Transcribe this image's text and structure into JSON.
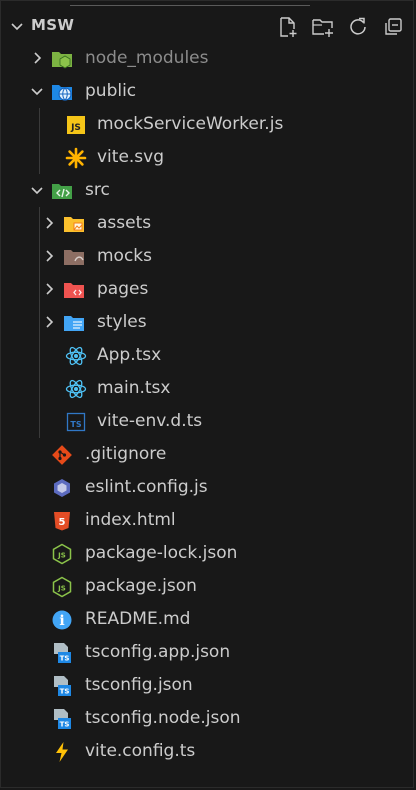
{
  "explorer": {
    "title": "MSW",
    "actions": [
      {
        "icon": "new-file-icon"
      },
      {
        "icon": "new-folder-icon"
      },
      {
        "icon": "refresh-icon"
      },
      {
        "icon": "collapse-all-icon"
      }
    ]
  },
  "tree": [
    {
      "label": "node_modules",
      "type": "folder",
      "expanded": false,
      "depth": 0,
      "icon": "node-modules-folder-icon",
      "dim": true
    },
    {
      "label": "public",
      "type": "folder",
      "expanded": true,
      "depth": 0,
      "icon": "public-folder-icon"
    },
    {
      "label": "mockServiceWorker.js",
      "type": "file",
      "depth": 1,
      "icon": "javascript-file-icon",
      "icon_text": "JS"
    },
    {
      "label": "vite.svg",
      "type": "file",
      "depth": 1,
      "icon": "svg-file-icon"
    },
    {
      "label": "src",
      "type": "folder",
      "expanded": true,
      "depth": 0,
      "icon": "src-folder-icon"
    },
    {
      "label": "assets",
      "type": "folder",
      "expanded": false,
      "depth": 1,
      "icon": "assets-folder-icon"
    },
    {
      "label": "mocks",
      "type": "folder",
      "expanded": false,
      "depth": 1,
      "icon": "mocks-folder-icon"
    },
    {
      "label": "pages",
      "type": "folder",
      "expanded": false,
      "depth": 1,
      "icon": "pages-folder-icon"
    },
    {
      "label": "styles",
      "type": "folder",
      "expanded": false,
      "depth": 1,
      "icon": "styles-folder-icon"
    },
    {
      "label": "App.tsx",
      "type": "file",
      "depth": 1,
      "icon": "react-file-icon"
    },
    {
      "label": "main.tsx",
      "type": "file",
      "depth": 1,
      "icon": "react-file-icon"
    },
    {
      "label": "vite-env.d.ts",
      "type": "file",
      "depth": 1,
      "icon": "typescript-file-icon",
      "icon_text": "TS"
    },
    {
      "label": ".gitignore",
      "type": "file",
      "depth": 0,
      "icon": "git-file-icon"
    },
    {
      "label": "eslint.config.js",
      "type": "file",
      "depth": 0,
      "icon": "eslint-file-icon"
    },
    {
      "label": "index.html",
      "type": "file",
      "depth": 0,
      "icon": "html-file-icon",
      "icon_text": "5"
    },
    {
      "label": "package-lock.json",
      "type": "file",
      "depth": 0,
      "icon": "nodejs-file-icon",
      "icon_text": "JS"
    },
    {
      "label": "package.json",
      "type": "file",
      "depth": 0,
      "icon": "nodejs-file-icon",
      "icon_text": "JS"
    },
    {
      "label": "README.md",
      "type": "file",
      "depth": 0,
      "icon": "info-file-icon",
      "icon_text": "i"
    },
    {
      "label": "tsconfig.app.json",
      "type": "file",
      "depth": 0,
      "icon": "tsconfig-file-icon",
      "icon_text": "TS"
    },
    {
      "label": "tsconfig.json",
      "type": "file",
      "depth": 0,
      "icon": "tsconfig-file-icon",
      "icon_text": "TS"
    },
    {
      "label": "tsconfig.node.json",
      "type": "file",
      "depth": 0,
      "icon": "tsconfig-file-icon",
      "icon_text": "TS"
    },
    {
      "label": "vite.config.ts",
      "type": "file",
      "depth": 0,
      "icon": "vite-file-icon"
    }
  ]
}
